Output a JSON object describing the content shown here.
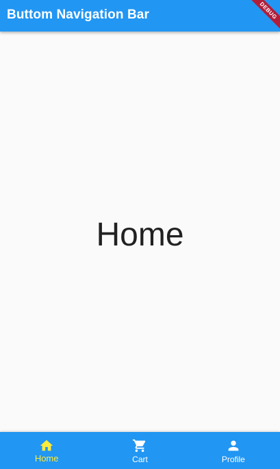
{
  "app_bar": {
    "title": "Buttom Navigation Bar",
    "color": "#2196f3"
  },
  "debug_banner": {
    "label": "DEBUG",
    "color": "#b11e3a"
  },
  "body": {
    "text": "Home"
  },
  "bottom_nav": {
    "background": "#2196f3",
    "active_color": "#ffeb3b",
    "inactive_color": "#ffffff",
    "selected_index": 0,
    "items": [
      {
        "label": "Home",
        "icon": "home-icon"
      },
      {
        "label": "Cart",
        "icon": "shopping-cart-icon"
      },
      {
        "label": "Profile",
        "icon": "person-icon"
      }
    ]
  }
}
